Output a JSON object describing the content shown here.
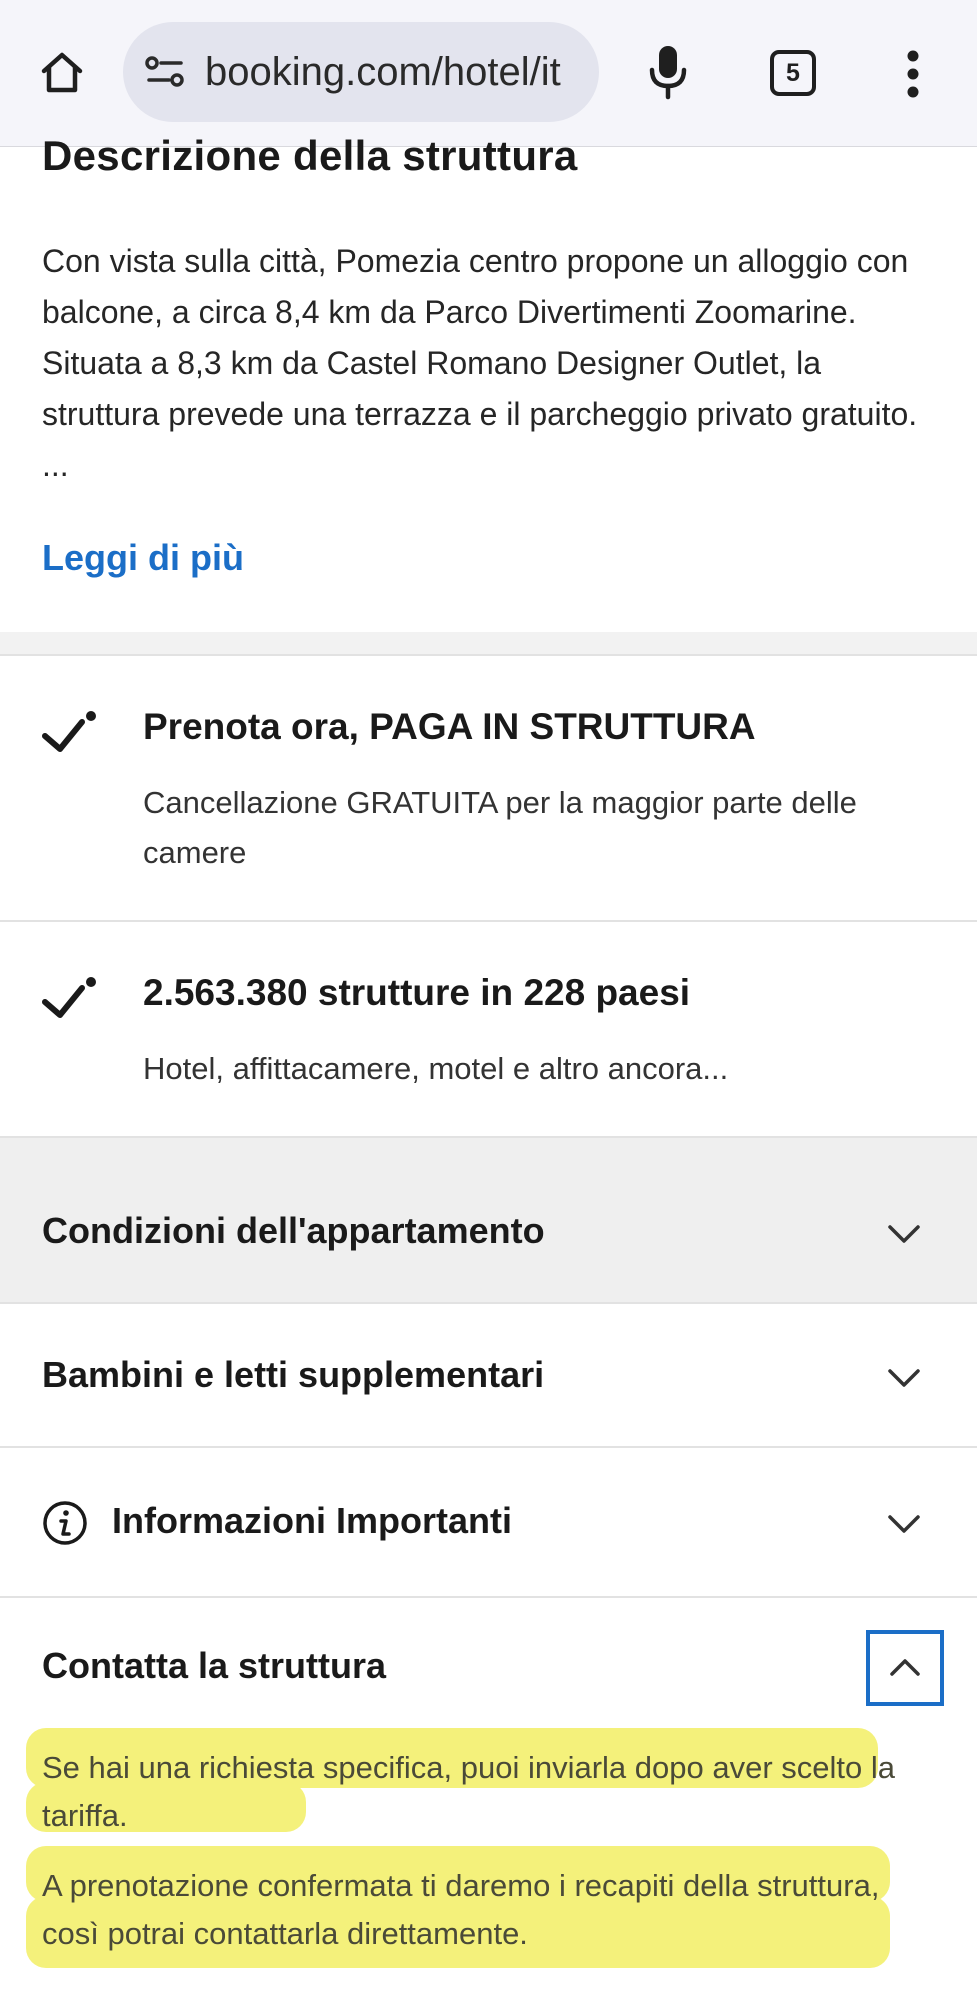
{
  "browser": {
    "url": "booking.com/hotel/it",
    "tab_count": "5"
  },
  "description": {
    "title": "Descrizione della struttura",
    "body": "Con vista sulla città, Pomezia centro propone un alloggio con balcone, a circa 8,4 km da Parco Divertimenti Zoomarine. Situata a 8,3 km da Castel Romano Designer Outlet, la struttura prevede una terrazza e il parcheggio privato gratuito. ...",
    "read_more": "Leggi di più"
  },
  "features": [
    {
      "title": "Prenota ora, PAGA IN STRUTTURA",
      "text": "Cancellazione GRATUITA per la maggior parte delle camere"
    },
    {
      "title": "2.563.380 strutture in 228 paesi",
      "text": "Hotel, affittacamere, motel e altro ancora..."
    }
  ],
  "accordions": [
    {
      "title": "Condizioni dell'appartamento"
    },
    {
      "title": "Bambini e letti supplementari"
    },
    {
      "title": "Informazioni Importanti"
    }
  ],
  "contact": {
    "title": "Contatta la struttura",
    "p1": "Se hai una richiesta specifica, puoi inviarla dopo aver scelto la tariffa.",
    "p2": "A prenotazione confermata ti daremo i recapiti della struttura, così potrai contattarla direttamente."
  },
  "colors": {
    "link": "#1b6ec7",
    "highlight": "#f4f17b",
    "accordion_active_bg": "#efefef"
  },
  "icons": [
    "home-icon",
    "site-settings-icon",
    "mic-icon",
    "tab-count-icon",
    "more-vert-icon",
    "check-icon",
    "chevron-down-icon",
    "chevron-up-icon",
    "info-icon"
  ]
}
